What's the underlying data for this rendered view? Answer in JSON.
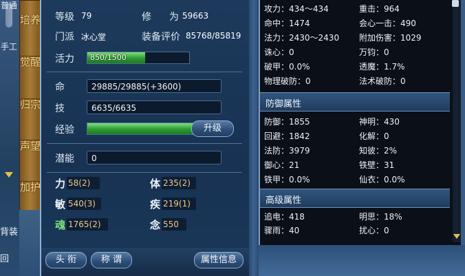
{
  "left_strip": {
    "tab_top": "普通",
    "tab_mid": "手工",
    "bottom_text1": "背装",
    "bottom_text2": "回"
  },
  "side_tabs": [
    "培养",
    "觉醒",
    "归宗",
    "声望",
    "加护"
  ],
  "character": {
    "level_label": "等级",
    "level_value": "79",
    "xiu_label": "修",
    "wei_label": "为",
    "cultivation_value": "59663",
    "sect_label": "门派",
    "sect_value": "冰心堂",
    "equip_label": "装备评价",
    "equip_value": "85768/85819",
    "vitality_label": "活力",
    "vitality_text": "850/1500",
    "vitality_ratio": 0.567,
    "hp_label": "命",
    "hp_value": "29885/29885(+3600)",
    "skill_label": "技",
    "skill_value": "6635/6635",
    "exp_label": "经验",
    "exp_ratio": 1.0,
    "upgrade_label": "升级",
    "potential_label": "潜能",
    "potential_value": "0"
  },
  "attributes": {
    "li_label": "力",
    "li_value": "58(2)",
    "ti_label": "体",
    "ti_value": "235(2)",
    "min_label": "敏",
    "min_value": "540(3)",
    "ji_label": "疾",
    "ji_value": "219(1)",
    "hun_label": "魂",
    "hun_value": "1765(2)",
    "nian_label": "念",
    "nian_value": "550"
  },
  "buttons": {
    "title": "头 衔",
    "appellation": "称 谓",
    "attr_info": "属性信息"
  },
  "stats": {
    "attack": "攻力：434～434",
    "crit": "重击：964",
    "hit": "命中：1474",
    "heart_strike": "会心一击：490",
    "magic": "法力：2430～2430",
    "extra_damage": "附加伤害：1029",
    "zhuxin": "诛心：0",
    "wanjun": "万钧：0",
    "pojia": "破甲：0.0%",
    "toulu": "透魔：1.7%",
    "phys_pen": "物理破防：0",
    "magic_pen": "法术破防：0"
  },
  "defense": {
    "header": "防御属性",
    "defense": "防御：1855",
    "shenming": "神明：430",
    "dodge": "回避：1842",
    "resolve": "化解：0",
    "magic_def": "法防：3979",
    "zhibi": "知彼：2%",
    "yuxin": "御心：21",
    "tiebi": "铁壁：31",
    "tiejia": "铁甲：0.0%",
    "xianyi": "仙衣：0.0%"
  },
  "advanced": {
    "header": "高级属性",
    "zhuidian": "追电：418",
    "mingsi": "明思：18%",
    "zhouyu": "骤雨：40",
    "raoxin": "扰心：0"
  },
  "colors": {
    "gold_text": "#f3d48a",
    "attr_value": "#f2c98a",
    "hun_green": "#7fe07f",
    "bar_green": "#2d9a32"
  }
}
